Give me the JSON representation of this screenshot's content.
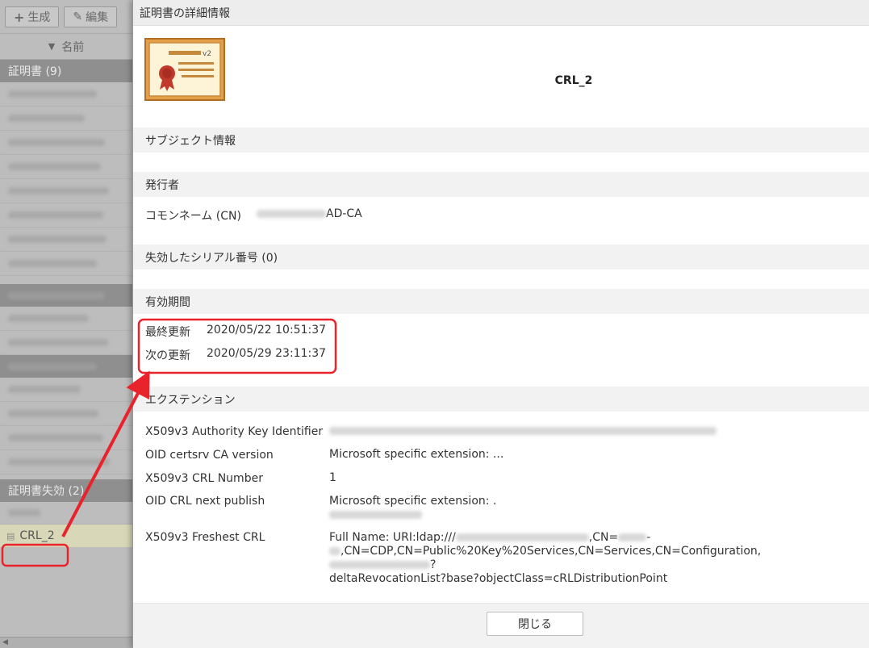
{
  "toolbar": {
    "generate_label": "生成",
    "edit_label": "編集"
  },
  "list": {
    "name_header": "名前",
    "group_certificates": "証明書 (9)",
    "group_revoked": "証明書失効 (2)",
    "crl_item": "CRL_2"
  },
  "dialog": {
    "title": "証明書の詳細情報",
    "cert_name": "CRL_2",
    "cert_badge": "v2",
    "sections": {
      "subject": "サブジェクト情報",
      "issuer": "発行者",
      "revoked_serials": "失効したシリアル番号 (0)",
      "validity": "有効期間",
      "extensions": "エクステンション"
    },
    "issuer_cn_label": "コモンネーム (CN)",
    "issuer_cn_value": "AD-CA",
    "last_update_label": "最終更新",
    "last_update_value": "2020/05/22 10:51:37",
    "next_update_label": "次の更新",
    "next_update_value": "2020/05/29 23:11:37",
    "extensions": {
      "aki_label": "X509v3 Authority Key Identifier",
      "ca_version_label": "OID certsrv CA version",
      "ca_version_value": "Microsoft specific extension: ...",
      "crl_number_label": "X509v3 CRL Number",
      "crl_number_value": "1",
      "next_publish_label": "OID CRL next publish",
      "next_publish_value": "Microsoft specific extension: .",
      "freshest_label": "X509v3 Freshest CRL",
      "freshest_part1": "Full Name: URI:ldap:///",
      "freshest_part2": ",CN=",
      "freshest_part3": "-",
      "freshest_part4": ",CN=CDP,CN=Public%20Key%20Services,CN=Services,CN=Configuration,",
      "freshest_part5": "?",
      "freshest_part6": "deltaRevocationList?base?objectClass=cRLDistributionPoint"
    },
    "close_label": "閉じる"
  },
  "colors": {
    "highlight": "#e8232b",
    "section_bg": "#f2f2f2",
    "title_bg": "#ededed"
  }
}
